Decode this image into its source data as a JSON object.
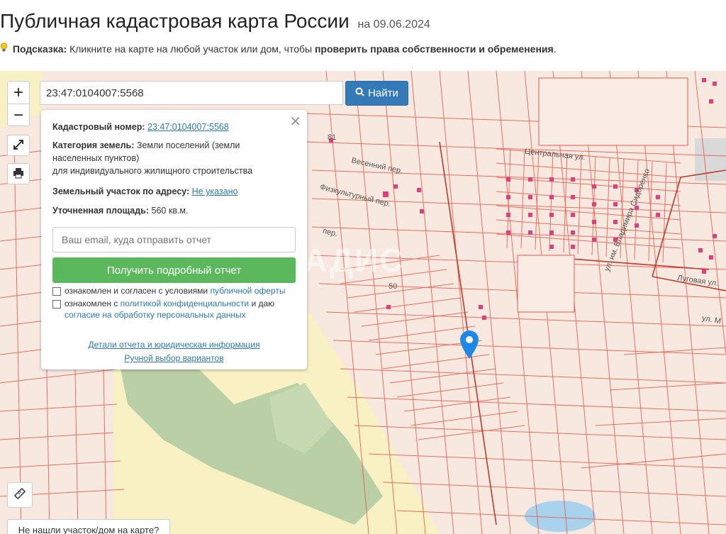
{
  "header": {
    "title": "Публичная кадастровая карта России",
    "date": "на 09.06.2024",
    "hint_label": "Подсказка:",
    "hint_text": " Кликните на карте на любой участок или дом, чтобы ",
    "hint_bold": "проверить права собственности и обременения",
    "hint_end": "."
  },
  "search": {
    "value": "23:47:0104007:5568",
    "button_label": "Найти"
  },
  "map_controls": {
    "zoom_in": "+",
    "zoom_out": "−"
  },
  "popup": {
    "close": "✕",
    "cadastral_label": "Кадастровый номер:",
    "cadastral_value": "23:47:0104007:5568",
    "category_label": "Категория земель:",
    "category_value_1": "Земли поселений (земли",
    "category_value_2": "населенных пунктов)",
    "category_value_3": "для индивидуального жилищного строительства",
    "address_label": "Земельный участок по адресу:",
    "address_value": "Не указано",
    "area_label": "Уточненная площадь:",
    "area_value": "560 кв.м.",
    "email_placeholder": "Ваш email, куда отправить отчет",
    "report_button": "Получить подробный отчет",
    "check1_text": "ознакомлен и согласен с условиями ",
    "check1_link": "публичной оферты",
    "check2_text": "ознакомлен с ",
    "check2_link": "политикой конфиденциальности",
    "check2_text2": " и даю",
    "check2_link2": "согласие на обработку персональных данных",
    "details_link": "Детали отчета и юридическая информация",
    "manual_link": "Ручной выбор вариантов"
  },
  "map_labels": {
    "central_street": "Центральная ул.",
    "vesenniy": "Весенний пер.",
    "fizkult": "Физкультурный пер.",
    "lugovaya": "Луговая ул.",
    "per": "пер.",
    "ul": "ул. М",
    "vladimir": "ул. им. Владимира Сидоренко",
    "num81": "81",
    "num50": "50",
    "watermark": "ВЛАДИС"
  },
  "footer": {
    "not_found": "Не нашли участок/дом на карте?"
  },
  "colors": {
    "parcel_line": "#e8584a",
    "building": "#e0407a",
    "search_btn": "#337ab7",
    "report_btn": "#5cb85c",
    "marker": "#1e88e5",
    "forest": "#b9cfa5",
    "yellow_area": "#f8f1c4",
    "water": "#a9d3ec"
  },
  "icons": {
    "bulb": "lightbulb-icon",
    "search": "search-icon",
    "expand": "expand-icon",
    "print": "print-icon",
    "ruler": "ruler-icon",
    "marker": "map-marker-icon"
  }
}
